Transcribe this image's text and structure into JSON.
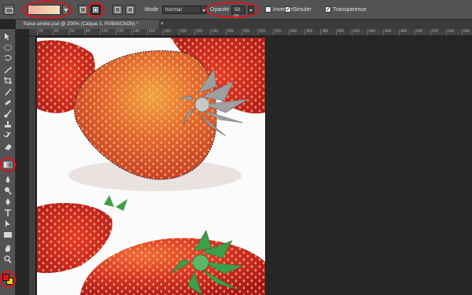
{
  "options_bar": {
    "mode_label": "Mode :",
    "mode_value": "Normal",
    "opacity_label": "Opacité :",
    "opacity_value": "50 %",
    "inverser_label": "Inverser",
    "simuler_label": "Simuler",
    "transparence_label": "Transparence",
    "inverser_checked": false,
    "simuler_checked": true,
    "transparence_checked": true,
    "gradient_colors": [
      "#f0a29a",
      "#f4c4a2",
      "#efe2b8"
    ],
    "gradient_styles": [
      "linear-gradient-icon",
      "radial-gradient-icon",
      "angle-gradient-icon",
      "reflected-gradient-icon",
      "diamond-gradient-icon"
    ],
    "active_gradient_style": "radial-gradient-icon"
  },
  "document": {
    "tab_title": "fraise-amitié.psd @ 200% (Calque 3, RVB/8/CMJN) *",
    "close_symbol": "×"
  },
  "ruler": {
    "labels": [
      "20",
      "40",
      "60",
      "80",
      "100",
      "120",
      "140",
      "160",
      "180",
      "200",
      "220",
      "240",
      "260",
      "280",
      "300",
      "320",
      "340",
      "360",
      "380",
      "400",
      "420",
      "440",
      "460",
      "480",
      "500",
      "520",
      "540",
      "560"
    ]
  },
  "tools": [
    "move-tool-icon",
    "marquee-tool-icon",
    "lasso-tool-icon",
    "magic-wand-icon",
    "crop-tool-icon",
    "eyedropper-icon",
    "healing-brush-icon",
    "brush-tool-icon",
    "clone-stamp-icon",
    "history-brush-icon",
    "eraser-icon",
    "gradient-tool-icon",
    "blur-tool-icon",
    "dodge-tool-icon",
    "pen-tool-icon",
    "type-tool-icon",
    "path-selection-icon",
    "rectangle-tool-icon",
    "hand-tool-icon",
    "zoom-tool-icon"
  ],
  "colors": {
    "foreground": "#e8101a",
    "background": "#f2d20a",
    "highlight_ring": "#e0131d"
  }
}
